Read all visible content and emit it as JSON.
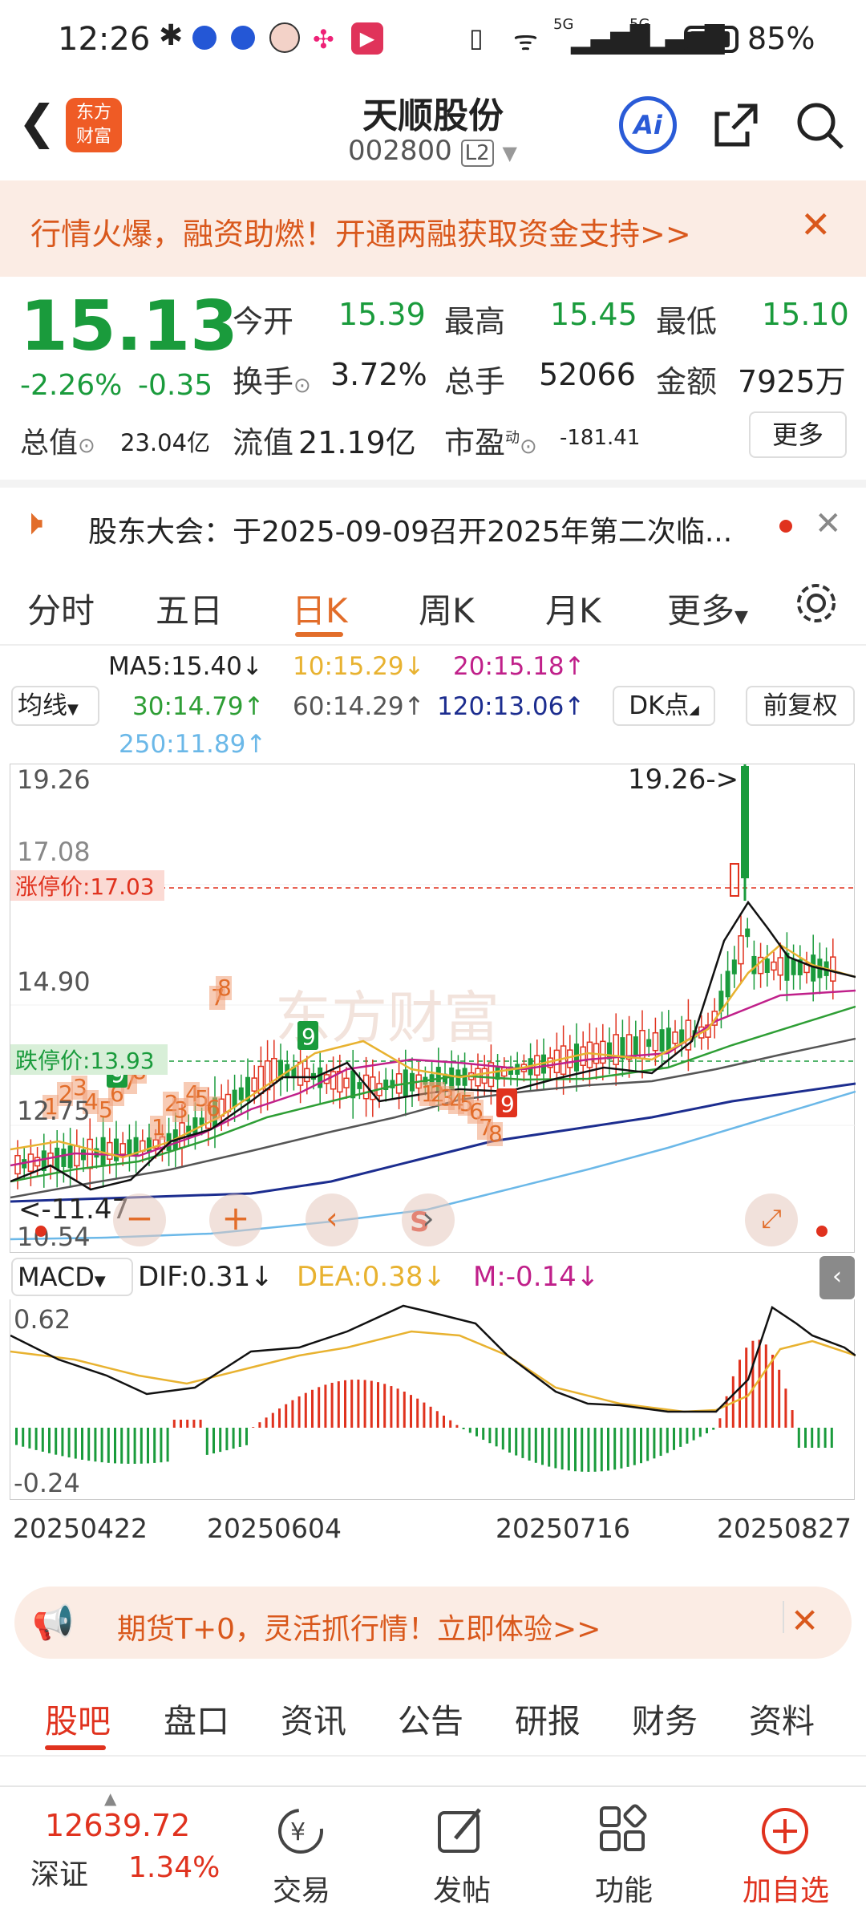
{
  "status_bar": {
    "time": "12:26",
    "battery": "85%",
    "signal1": "6",
    "net1": "5G",
    "net2": "5G"
  },
  "header": {
    "title": "天顺股份",
    "code": "002800",
    "level": "L2",
    "logo_line1": "东方",
    "logo_line2": "财富",
    "ai_label": "Ai"
  },
  "promo": {
    "text": "行情火爆，融资助燃！开通两融获取资金支持>>"
  },
  "quote": {
    "price": "15.13",
    "change_pct": "-2.26%",
    "change": "-0.35",
    "open_label": "今开",
    "open": "15.39",
    "high_label": "最高",
    "high": "15.45",
    "low_label": "最低",
    "low": "15.10",
    "turnover_label": "换手",
    "turnover": "3.72%",
    "volume_label": "总手",
    "volume": "52066",
    "amount_label": "金额",
    "amount": "7925万",
    "mktcap_label": "总值",
    "mktcap": "23.04亿",
    "float_label": "流值",
    "float": "21.19亿",
    "pe_label": "市盈",
    "pe_sup": "动",
    "pe": "-181.41",
    "more": "更多"
  },
  "notice": {
    "text": "股东大会：于2025-09-09召开2025年第二次临..."
  },
  "tabs": [
    "分时",
    "五日",
    "日K",
    "周K",
    "月K",
    "更多"
  ],
  "ma": {
    "selector": "均线",
    "ma5": "MA5:15.40↓",
    "ma10": "10:15.29↓",
    "ma20": "20:15.18↑",
    "ma30": "30:14.79↑",
    "ma60": "60:14.29↑",
    "ma120": "120:13.06↑",
    "ma250": "250:11.89↑",
    "dk": "DK点",
    "fq": "前复权"
  },
  "chart": {
    "max_label": "19.26",
    "max_pointer": "19.26->",
    "limit_up": "涨停价:17.03",
    "limit_down": "跌停价:13.93",
    "y2": "17.08",
    "y3": "14.90",
    "y4": "12.75",
    "min_label": "10.54",
    "min_pointer": "<-11.47",
    "watermark": "东方财富",
    "s_mark": "S",
    "nine_labels": [
      "9",
      "9",
      "9"
    ]
  },
  "macd": {
    "selector": "MACD",
    "dif": "DIF:0.31↓",
    "dea": "DEA:0.38↓",
    "m": "M:-0.14↓",
    "top": "0.62",
    "bottom": "-0.24"
  },
  "dates": [
    "20250422",
    "20250604",
    "20250716",
    "20250827"
  ],
  "futures": {
    "text": "期货T+0，灵活抓行情！立即体验>>"
  },
  "subtabs": [
    "股吧",
    "盘口",
    "资讯",
    "公告",
    "研报",
    "财务",
    "资料"
  ],
  "bottom": {
    "index_value": "12639.72",
    "index_name": "深证",
    "index_pct": "1.34%",
    "trade": "交易",
    "post": "发帖",
    "func": "功能",
    "add": "加自选"
  },
  "colors": {
    "accent": "#e26d2a",
    "up": "#e0321e",
    "down": "#1a9b3c"
  }
}
